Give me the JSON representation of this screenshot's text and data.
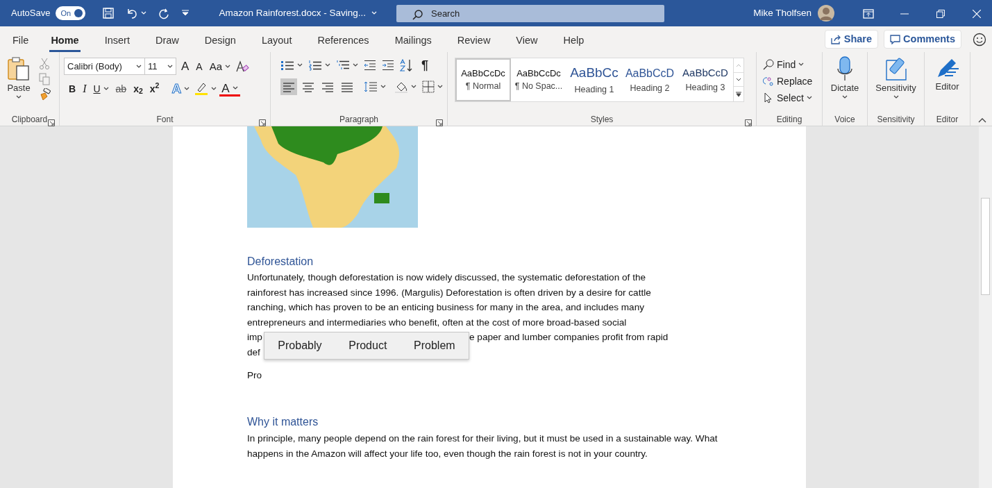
{
  "title_bar": {
    "autosave_label": "AutoSave",
    "autosave_toggle": {
      "label": "On",
      "on": true
    },
    "document_title": "Amazon Rainforest.docx  -  Saving...",
    "search": {
      "placeholder": "Search"
    },
    "user_name": "Mike Tholfsen"
  },
  "menu_tabs": [
    {
      "label": "File",
      "selected": false
    },
    {
      "label": "Home",
      "selected": true
    },
    {
      "label": "Insert",
      "selected": false
    },
    {
      "label": "Draw",
      "selected": false
    },
    {
      "label": "Design",
      "selected": false
    },
    {
      "label": "Layout",
      "selected": false
    },
    {
      "label": "References",
      "selected": false
    },
    {
      "label": "Mailings",
      "selected": false
    },
    {
      "label": "Review",
      "selected": false
    },
    {
      "label": "View",
      "selected": false
    },
    {
      "label": "Help",
      "selected": false
    }
  ],
  "share_button": "Share",
  "comments_button": "Comments",
  "ribbon": {
    "clipboard": {
      "paste_label": "Paste",
      "group_label": "Clipboard"
    },
    "font": {
      "font_name": "Calibri (Body)",
      "font_size": "11",
      "grow_label": "A",
      "shrink_label": "A",
      "case_label": "Aa",
      "format_buttons": [
        {
          "kind": "bold",
          "label": "B"
        },
        {
          "kind": "italic",
          "label": "I"
        },
        {
          "kind": "underline",
          "label": "U"
        },
        {
          "kind": "strike",
          "label": "ab"
        },
        {
          "kind": "subscript",
          "label": "x$_{2}$"
        },
        {
          "kind": "superscript",
          "label": "x$^{2}$"
        }
      ],
      "effects_label": "A",
      "color_label": "A",
      "group_label": "Font"
    },
    "paragraph": {
      "pilcrow": "¶",
      "alignments": [
        {
          "kind": "left",
          "selected": true
        },
        {
          "kind": "center",
          "selected": false
        },
        {
          "kind": "right",
          "selected": false
        },
        {
          "kind": "justify",
          "selected": false
        }
      ],
      "group_label": "Paragraph"
    },
    "styles": {
      "items": [
        {
          "preview": "AaBbCcDc",
          "name": "¶ Normal",
          "kind": "normal",
          "selected": true
        },
        {
          "preview": "AaBbCcDc",
          "name": "¶ No Spac...",
          "kind": "normal",
          "selected": false
        },
        {
          "preview": "AaBbCc",
          "name": "Heading 1",
          "kind": "heading1",
          "selected": false
        },
        {
          "preview": "AaBbCcD",
          "name": "Heading 2",
          "kind": "heading2",
          "selected": false
        },
        {
          "preview": "AaBbCcD",
          "name": "Heading 3",
          "kind": "heading3",
          "selected": false
        }
      ],
      "group_label": "Styles"
    },
    "editing": {
      "find": "Find",
      "replace": "Replace",
      "select": "Select",
      "group_label": "Editing"
    },
    "voice": {
      "dictate": "Dictate",
      "group_label": "Voice"
    },
    "sensitivity": {
      "button": "Sensitivity",
      "group_label": "Sensitivity"
    },
    "editor": {
      "button": "Editor",
      "group_label": "Editor"
    }
  },
  "document": {
    "heading_1": "Deforestation",
    "paragraph_1_lines": [
      [
        "Unfortunately, though deforestation is now widely discussed, the systematic deforestation of the"
      ],
      [
        "rainforest has increased since 1996. (Margulis) Deforestation is often driven by a desire for cattle"
      ],
      [
        "ranching, which has proven to be an enticing business for many in the area, and includes many"
      ],
      [
        "entrepreneurs and intermediaries who benefit, often at the cost of more broad-based social"
      ],
      [
        "imp",
        "e paper and lumber companies profit from rapid"
      ],
      [
        "def"
      ]
    ],
    "typed_text": "Pro",
    "heading_2": "Why it matters",
    "paragraph_2": "In principle, many people depend on the rain forest for their living, but it must be used in a sustainable way. What happens in the Amazon will affect your life too, even though the rain forest is not in your country."
  },
  "suggestions": [
    "Probably",
    "Product",
    "Problem"
  ]
}
